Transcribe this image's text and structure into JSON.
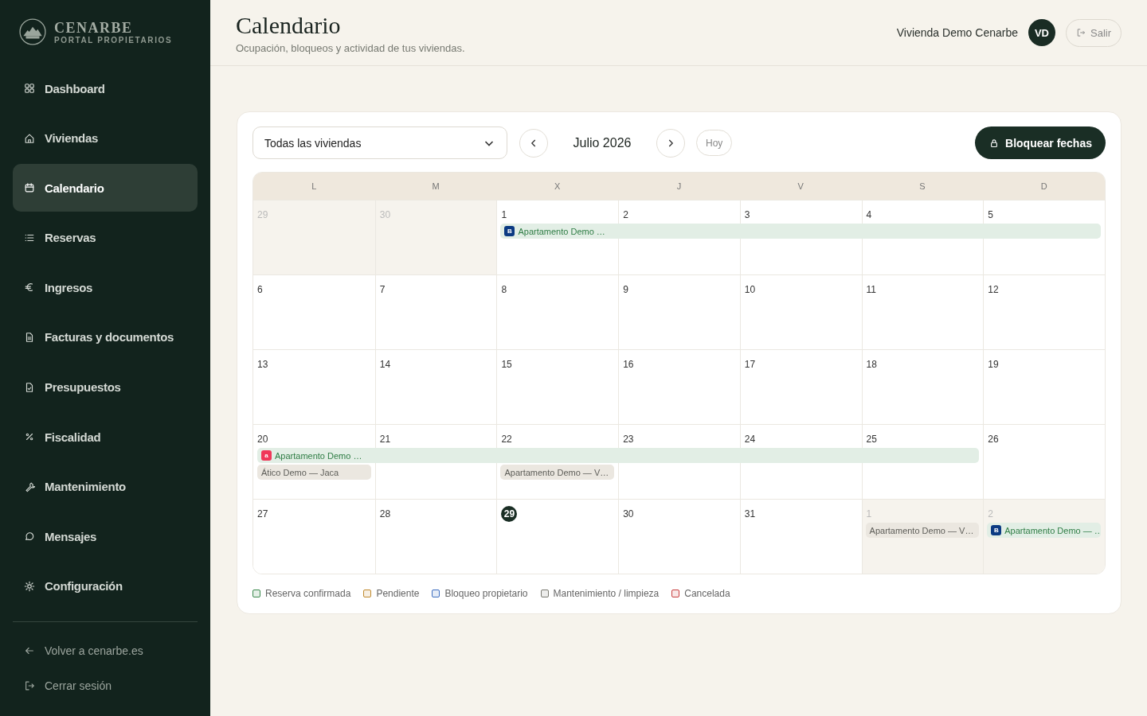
{
  "brand": {
    "name": "CENARBE",
    "subtitle": "PORTAL PROPIETARIOS"
  },
  "sidebar": {
    "items": [
      {
        "label": "Dashboard",
        "selected": false
      },
      {
        "label": "Viviendas",
        "selected": false
      },
      {
        "label": "Calendario",
        "selected": true
      },
      {
        "label": "Reservas",
        "selected": false
      },
      {
        "label": "Ingresos",
        "selected": false
      },
      {
        "label": "Facturas y documentos",
        "selected": false
      },
      {
        "label": "Presupuestos",
        "selected": false
      },
      {
        "label": "Fiscalidad",
        "selected": false
      },
      {
        "label": "Mantenimiento",
        "selected": false
      },
      {
        "label": "Mensajes",
        "selected": false
      },
      {
        "label": "Configuración",
        "selected": false
      }
    ],
    "footer_links": [
      "Volver a cenarbe.es",
      "Cerrar sesión"
    ]
  },
  "header": {
    "title": "Calendario",
    "subtitle": "Ocupación, bloqueos y actividad de tus viviendas.",
    "user": "Vivienda Demo Cenarbe",
    "avatar": "VD",
    "logout": "Salir"
  },
  "toolbar": {
    "property_select": "Todas las viviendas",
    "month": "Julio 2026",
    "today": "Hoy",
    "block_button": "Bloquear fechas"
  },
  "calendar": {
    "weekdays": [
      "L",
      "M",
      "X",
      "J",
      "V",
      "S",
      "D"
    ],
    "weeks": [
      {
        "days": [
          {
            "day": "29",
            "outside": true,
            "today": false
          },
          {
            "day": "30",
            "outside": true,
            "today": false
          },
          {
            "day": "1",
            "outside": false,
            "today": false
          },
          {
            "day": "2",
            "outside": false,
            "today": false
          },
          {
            "day": "3",
            "outside": false,
            "today": false
          },
          {
            "day": "4",
            "outside": false,
            "today": false
          },
          {
            "day": "5",
            "outside": false,
            "today": false
          }
        ],
        "events": [
          {
            "label": "Apartamento Demo …",
            "kind": "confirmed",
            "badge": {
              "text": "B",
              "kind": "booking"
            }
          }
        ]
      },
      {
        "days": [
          {
            "day": "6",
            "outside": false,
            "today": false
          },
          {
            "day": "7",
            "outside": false,
            "today": false
          },
          {
            "day": "8",
            "outside": false,
            "today": false
          },
          {
            "day": "9",
            "outside": false,
            "today": false
          },
          {
            "day": "10",
            "outside": false,
            "today": false
          },
          {
            "day": "11",
            "outside": false,
            "today": false
          },
          {
            "day": "12",
            "outside": false,
            "today": false
          }
        ]
      },
      {
        "days": [
          {
            "day": "13",
            "outside": false,
            "today": false
          },
          {
            "day": "14",
            "outside": false,
            "today": false
          },
          {
            "day": "15",
            "outside": false,
            "today": false
          },
          {
            "day": "16",
            "outside": false,
            "today": false
          },
          {
            "day": "17",
            "outside": false,
            "today": false
          },
          {
            "day": "18",
            "outside": false,
            "today": false
          },
          {
            "day": "19",
            "outside": false,
            "today": false
          }
        ]
      },
      {
        "days": [
          {
            "day": "20",
            "outside": false,
            "today": false
          },
          {
            "day": "21",
            "outside": false,
            "today": false
          },
          {
            "day": "22",
            "outside": false,
            "today": false
          },
          {
            "day": "23",
            "outside": false,
            "today": false
          },
          {
            "day": "24",
            "outside": false,
            "today": false
          },
          {
            "day": "25",
            "outside": false,
            "today": false
          },
          {
            "day": "26",
            "outside": false,
            "today": false
          }
        ],
        "events": [
          {
            "label": "Apartamento Demo …",
            "kind": "confirmed",
            "badge": {
              "text": "a",
              "kind": "airbnb"
            }
          },
          {
            "label": "Ático Demo — Jaca",
            "kind": "maintenance"
          },
          {
            "label": "Apartamento Demo — V…",
            "kind": "maintenance"
          }
        ]
      },
      {
        "days": [
          {
            "day": "27",
            "outside": false,
            "today": false
          },
          {
            "day": "28",
            "outside": false,
            "today": false
          },
          {
            "day": "29",
            "outside": false,
            "today": true
          },
          {
            "day": "30",
            "outside": false,
            "today": false
          },
          {
            "day": "31",
            "outside": false,
            "today": false
          },
          {
            "day": "1",
            "outside": true,
            "today": false
          },
          {
            "day": "2",
            "outside": true,
            "today": false
          }
        ],
        "events": [
          {
            "label": "Apartamento Demo — V…",
            "kind": "maintenance"
          },
          {
            "label": "Apartamento Demo — …",
            "kind": "confirmed",
            "badge": {
              "text": "B",
              "kind": "booking"
            }
          }
        ]
      }
    ]
  },
  "legend": [
    {
      "label": "Reserva confirmada",
      "color": "#3c8a4e"
    },
    {
      "label": "Pendiente",
      "color": "#c08a2e"
    },
    {
      "label": "Bloqueo propietario",
      "color": "#3f6fc0"
    },
    {
      "label": "Mantenimiento / limpieza",
      "color": "#7a7a72"
    },
    {
      "label": "Cancelada",
      "color": "#c84040"
    }
  ]
}
